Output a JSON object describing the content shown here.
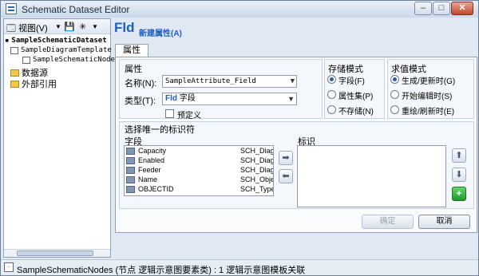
{
  "window": {
    "title": "Schematic Dataset Editor",
    "minimize": "–",
    "maximize": "□",
    "close": "✕"
  },
  "toolbar": {
    "view_label": "视图(V)"
  },
  "tree": {
    "root": "SampleSchematicDataset",
    "template": "SampleDiagramTemplate",
    "nodes": "SampleSchematicNodes",
    "datasources": "数据源",
    "external_refs": "外部引用"
  },
  "header": {
    "icon_text": "Fld",
    "label": "新建属性(A)"
  },
  "tab": {
    "label": "属性"
  },
  "attr": {
    "group_label": "属性",
    "name_label": "名称(N):",
    "name_value": "SampleAttribute_Field",
    "type_label": "类型(T):",
    "type_prefix": "Fld",
    "type_value": "字段",
    "predefined_label": "预定义"
  },
  "storage": {
    "group_label": "存储模式",
    "options": [
      "字段(F)",
      "属性集(P)",
      "不存储(N)"
    ],
    "selected": 0
  },
  "evaluation": {
    "group_label": "求值模式",
    "options": [
      "生成/更新时(G)",
      "开始编辑时(S)",
      "重绘/刷新时(E)"
    ],
    "selected": 0
  },
  "unique": {
    "group_label": "选择唯一的标识符",
    "fields_label": "字段",
    "id_label": "标识",
    "fields": [
      {
        "name": "Capacity",
        "type": "SCH_Diag"
      },
      {
        "name": "Enabled",
        "type": "SCH_Diag"
      },
      {
        "name": "Feeder",
        "type": "SCH_Diag"
      },
      {
        "name": "Name",
        "type": "SCH_Obje"
      },
      {
        "name": "OBJECTID",
        "type": "SCH_Type"
      }
    ]
  },
  "buttons": {
    "ok": "确定",
    "cancel": "取消"
  },
  "status": {
    "text": "SampleSchematicNodes (节点 逻辑示意图要素类) : 1 逻辑示意图模板关联"
  }
}
